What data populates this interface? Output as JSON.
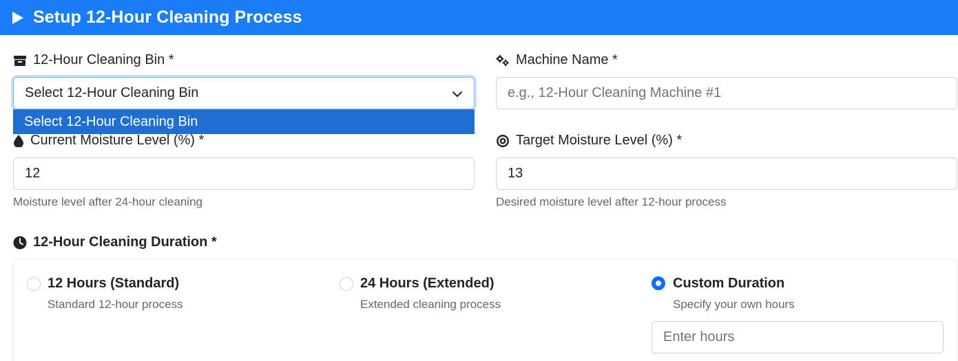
{
  "header": {
    "title": "Setup 12-Hour Cleaning Process",
    "icon": "play-icon"
  },
  "bin": {
    "label": "12-Hour Cleaning Bin *",
    "icon": "box-icon",
    "selected": "Select 12-Hour Cleaning Bin",
    "options": [
      "Select 12-Hour Cleaning Bin"
    ]
  },
  "machine": {
    "label": "Machine Name *",
    "icon": "gears-icon",
    "placeholder": "e.g., 12-Hour Cleaning Machine #1"
  },
  "current_moisture": {
    "label": "Current Moisture Level (%) *",
    "icon": "droplet-icon",
    "value": "12",
    "help": "Moisture level after 24-hour cleaning"
  },
  "target_moisture": {
    "label": "Target Moisture Level (%) *",
    "icon": "target-icon",
    "value": "13",
    "help": "Desired moisture level after 12-hour process"
  },
  "duration": {
    "label": "12-Hour Cleaning Duration *",
    "icon": "clock-icon",
    "options": [
      {
        "title": "12 Hours (Standard)",
        "desc": "Standard 12-hour process",
        "checked": false
      },
      {
        "title": "24 Hours (Extended)",
        "desc": "Extended cleaning process",
        "checked": false
      },
      {
        "title": "Custom Duration",
        "desc": "Specify your own hours",
        "checked": true
      }
    ],
    "custom_placeholder": "Enter hours"
  },
  "colors": {
    "header_bg": "#1a7cf6",
    "accent": "#0d6efd",
    "dropdown_highlight": "#1f6fd0"
  }
}
